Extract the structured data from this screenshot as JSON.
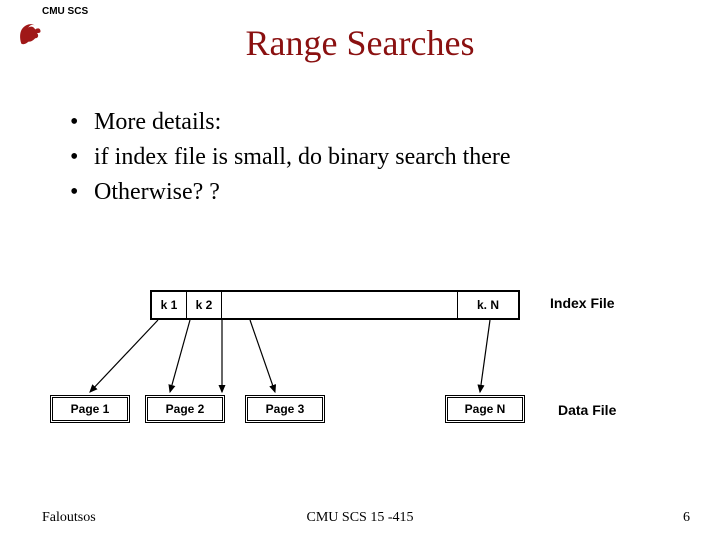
{
  "header_label": "CMU SCS",
  "title": "Range Searches",
  "bullets": [
    "More details:",
    "if index file is small, do binary search there",
    "Otherwise? ?"
  ],
  "index_keys": {
    "k1": "k 1",
    "k2": "k 2",
    "kn": "k. N"
  },
  "labels": {
    "index_file": "Index File",
    "data_file": "Data File"
  },
  "pages": {
    "p1": "Page 1",
    "p2": "Page 2",
    "p3": "Page 3",
    "pn": "Page N"
  },
  "footer": {
    "left": "Faloutsos",
    "center": "CMU SCS 15 -415",
    "right": "6"
  }
}
